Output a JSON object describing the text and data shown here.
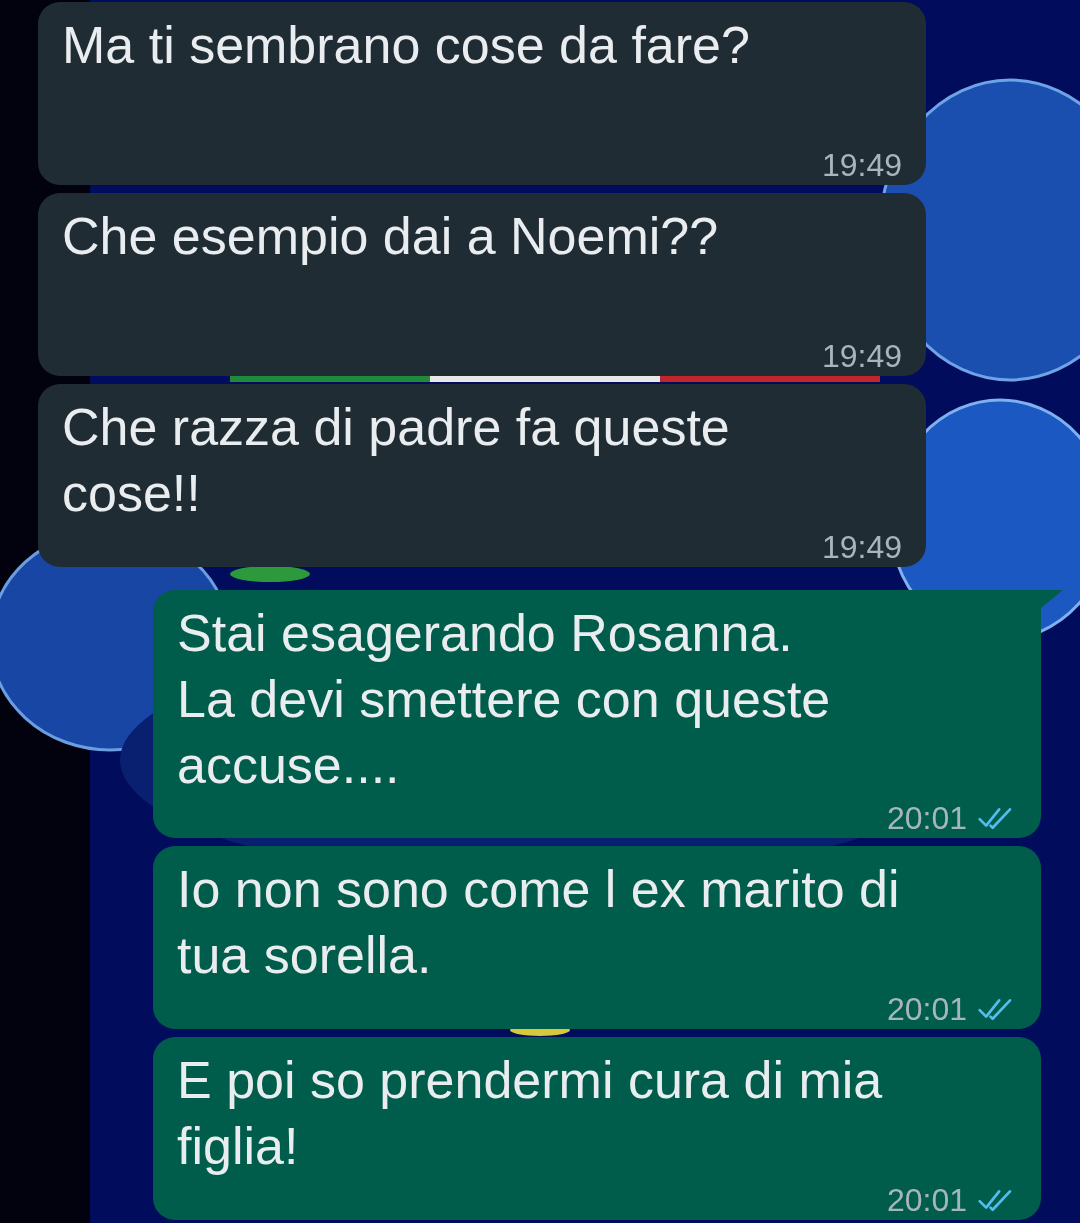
{
  "messages": [
    {
      "kind": "incoming",
      "text": "Ma ti sembrano cose da fare?",
      "time": "19:49",
      "tail": false
    },
    {
      "kind": "incoming",
      "text": "Che esempio dai a Noemi??",
      "time": "19:49",
      "tail": false
    },
    {
      "kind": "incoming",
      "text": "Che razza di padre fa queste cose!!",
      "time": "19:49",
      "tail": false
    },
    {
      "kind": "outgoing",
      "text": "Stai esagerando Rosanna.\nLa devi smettere con queste accuse....",
      "time": "20:01",
      "tail": true,
      "read": true
    },
    {
      "kind": "outgoing",
      "text": "Io non sono come l ex marito di tua sorella.",
      "time": "20:01",
      "tail": false,
      "read": true
    },
    {
      "kind": "outgoing",
      "text": "E poi so prendermi cura di mia figlia!",
      "time": "20:01",
      "tail": false,
      "read": true
    }
  ]
}
